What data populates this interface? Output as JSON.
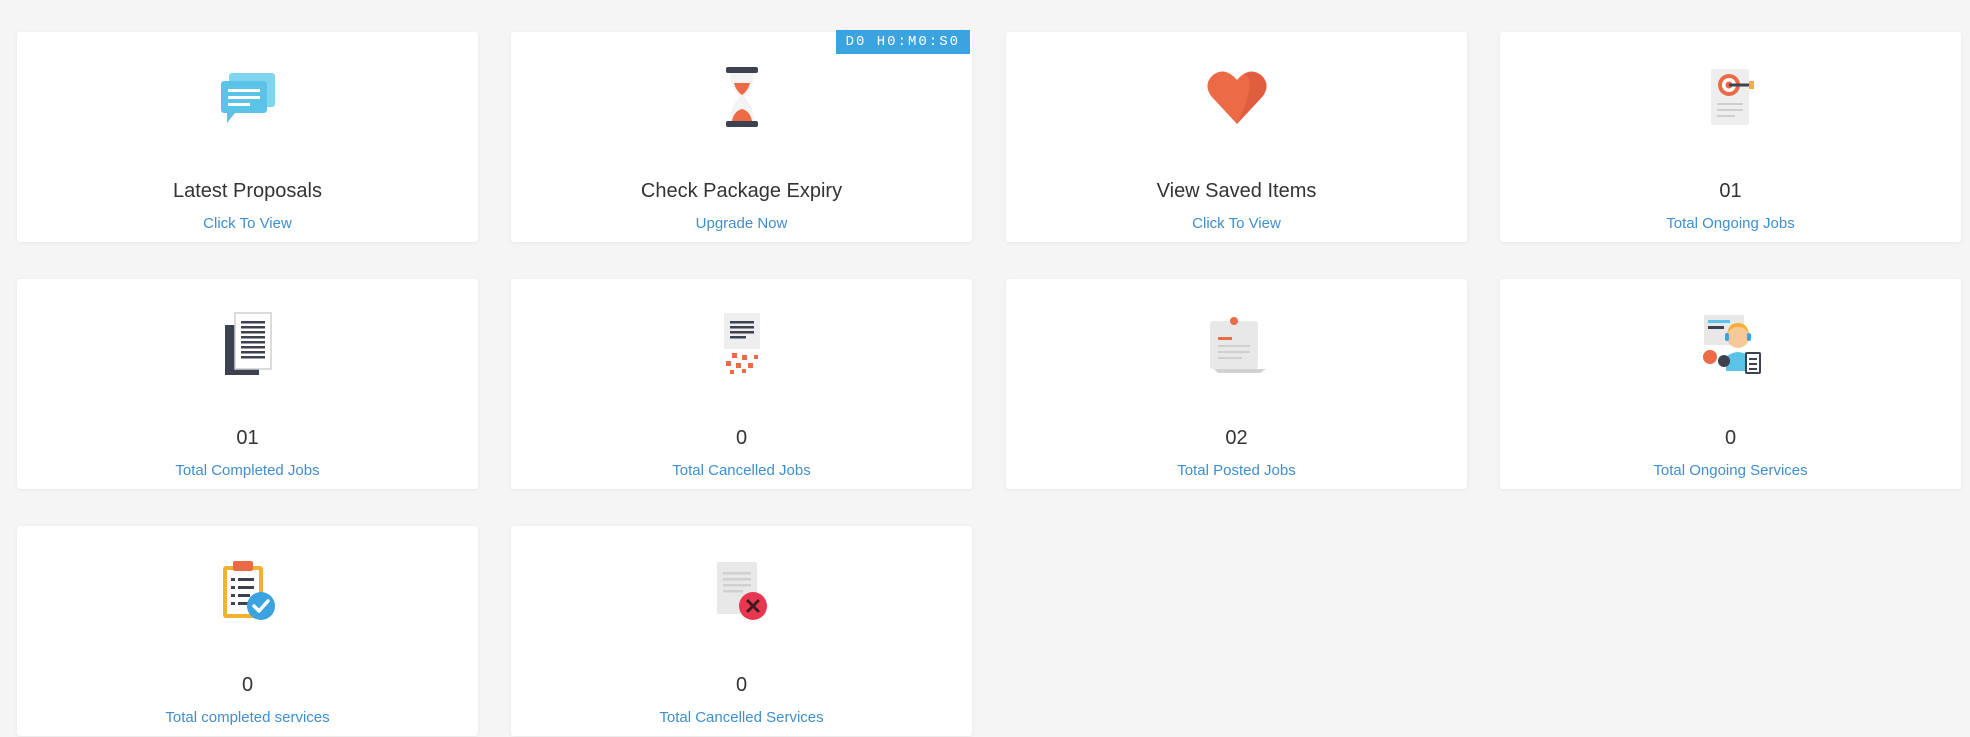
{
  "cards": [
    {
      "title": "Latest Proposals",
      "sub": "Click To View",
      "icon": "chat-bubbles-icon"
    },
    {
      "title": "Check Package Expiry",
      "sub": "Upgrade Now",
      "icon": "hourglass-icon",
      "badge": "D0 H0:M0:S0"
    },
    {
      "title": "View Saved Items",
      "sub": "Click To View",
      "icon": "heart-icon"
    },
    {
      "title": "01",
      "sub": "Total Ongoing Jobs",
      "icon": "target-document-icon"
    },
    {
      "title": "01",
      "sub": "Total Completed Jobs",
      "icon": "documents-icon"
    },
    {
      "title": "0",
      "sub": "Total Cancelled Jobs",
      "icon": "torn-document-icon"
    },
    {
      "title": "02",
      "sub": "Total Posted Jobs",
      "icon": "posted-note-icon"
    },
    {
      "title": "0",
      "sub": "Total Ongoing Services",
      "icon": "support-agent-icon"
    },
    {
      "title": "0",
      "sub": "Total completed services",
      "icon": "clipboard-check-icon"
    },
    {
      "title": "0",
      "sub": "Total Cancelled Services",
      "icon": "document-cancel-icon"
    }
  ],
  "colors": {
    "accent": "#3aa3e0",
    "link": "#3f8ecf",
    "heart": "#ec6a45"
  }
}
